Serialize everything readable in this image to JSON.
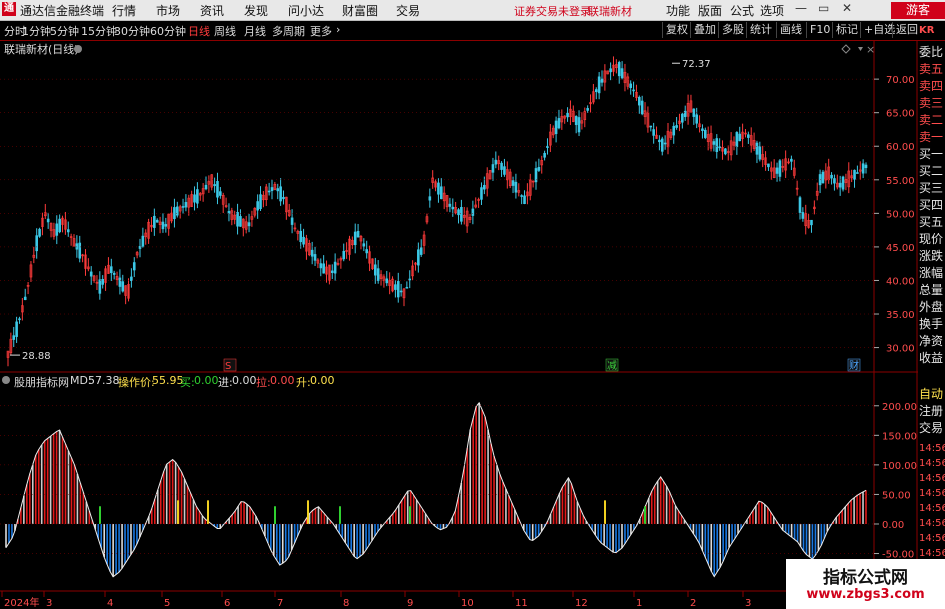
{
  "window": {
    "app_title": "通达信金融终端",
    "logo_glyph": "通",
    "menu": [
      "行情",
      "市场",
      "资讯",
      "发现",
      "问小达",
      "财富圈",
      "交易"
    ],
    "notice": "证券交易未登录",
    "stock_name": "联瑞新材",
    "right_menu": [
      "功能",
      "版面",
      "公式",
      "选项"
    ],
    "window_controls": [
      "—",
      "▭",
      "✕"
    ],
    "guest_label": "游客"
  },
  "periods": {
    "items": [
      "分时",
      "1分钟",
      "5分钟",
      "15分钟",
      "30分钟",
      "60分钟",
      "日线",
      "周线",
      "月线",
      "多周期",
      "更多"
    ],
    "active": "日线",
    "more_arrow": "›"
  },
  "toolbar_right": [
    "复权",
    "叠加",
    "多股",
    "统计",
    "画线",
    "F10",
    "标记",
    "+自选",
    "返回"
  ],
  "main_panel": {
    "title": "联瑞新材(日线)",
    "y_ticks": [
      "70.00",
      "65.00",
      "60.00",
      "55.00",
      "50.00",
      "45.00",
      "40.00",
      "35.00",
      "30.00"
    ],
    "high_label": "72.37",
    "low_label": "28.88",
    "event_marks": [
      {
        "text": "S",
        "color": "#ff3b3b"
      },
      {
        "text": "减",
        "color": "#3bd23b"
      },
      {
        "text": "财",
        "color": "#4da6ff"
      }
    ]
  },
  "indicator_panel": {
    "name": "股朋指标网",
    "md_label": "MD:",
    "md_value": "57.38",
    "op_label": "操作价:",
    "op_value": "55.95",
    "buy_label": "买:",
    "buy_value": "0.00",
    "in_label": "进:",
    "in_value": "0.00",
    "pull_label": "拉:",
    "pull_value": "0.00",
    "up_label": "升:",
    "up_value": "0.00",
    "y_ticks": [
      "200.00",
      "150.00",
      "100.00",
      "50.00",
      "0.00",
      "-50.00"
    ]
  },
  "x_axis": {
    "labels": [
      "2024年",
      "3",
      "4",
      "5",
      "6",
      "7",
      "8",
      "9",
      "10",
      "11",
      "12",
      "1",
      "2",
      "3",
      "4"
    ]
  },
  "side_panel": {
    "code": "KR",
    "labels": [
      "委比",
      "卖五",
      "卖四",
      "卖三",
      "卖二",
      "卖一",
      "买一",
      "买二",
      "买三",
      "买四",
      "买五",
      "现价",
      "涨跌",
      "涨幅",
      "总量",
      "外盘",
      "换手",
      "净资",
      "收益"
    ],
    "bottom_labels": [
      "自动",
      "注册",
      "交易"
    ],
    "times": [
      "14:56",
      "14:56",
      "14:56",
      "14:56",
      "14:56",
      "14:56",
      "14:56",
      "14:56"
    ]
  },
  "watermark": {
    "line1": "指标公式网",
    "line2": "www.zbgs3.com"
  },
  "colors": {
    "up": "#ff3b3b",
    "down": "#3cc8e6",
    "grid": "#8b0000",
    "pos_bar": "#e01a1a",
    "neg_bar": "#1a78e0",
    "signal_green": "#30d030",
    "signal_yellow": "#f0d020"
  },
  "chart_data": [
    {
      "type": "candlestick",
      "title": "联瑞新材(日线)",
      "ylim": [
        28,
        73
      ],
      "high": 72.37,
      "low": 28.88,
      "series": [
        {
          "values": [
            29,
            33,
            38,
            45,
            50,
            47,
            49,
            46,
            44,
            41,
            39,
            42,
            40,
            38,
            44,
            47,
            49,
            48,
            50,
            51,
            52,
            53,
            55,
            53,
            50,
            49,
            48,
            51,
            53,
            54,
            52,
            48,
            46,
            44,
            42,
            41,
            43,
            45,
            47,
            44,
            41,
            40,
            39,
            38,
            42,
            45,
            55,
            53,
            51,
            50,
            49,
            52,
            55,
            58,
            56,
            54,
            52,
            55,
            58,
            62,
            64,
            65,
            63,
            66,
            69,
            71,
            72,
            70,
            68,
            65,
            62,
            60,
            62,
            64,
            66,
            63,
            61,
            60,
            59,
            61,
            62,
            60,
            58,
            56,
            57,
            58,
            50,
            48,
            55,
            56,
            54,
            55,
            56,
            57
          ]
        }
      ]
    },
    {
      "type": "bar",
      "title": "股朋指标网",
      "ylim": [
        -110,
        225
      ],
      "series": [
        {
          "name": "MD",
          "values": [
            -40,
            -20,
            30,
            80,
            120,
            140,
            150,
            160,
            130,
            100,
            60,
            20,
            -20,
            -60,
            -90,
            -80,
            -60,
            -40,
            -10,
            20,
            60,
            100,
            110,
            90,
            60,
            30,
            10,
            0,
            -10,
            5,
            20,
            40,
            30,
            10,
            -20,
            -50,
            -70,
            -60,
            -30,
            0,
            20,
            30,
            15,
            0,
            -20,
            -40,
            -60,
            -50,
            -30,
            -10,
            5,
            20,
            40,
            60,
            40,
            20,
            0,
            -10,
            -5,
            20,
            80,
            160,
            210,
            180,
            120,
            80,
            50,
            20,
            -10,
            -30,
            -20,
            0,
            30,
            60,
            80,
            40,
            10,
            -10,
            -30,
            -40,
            -50,
            -40,
            -20,
            0,
            30,
            60,
            80,
            60,
            30,
            10,
            -10,
            -30,
            -60,
            -90,
            -70,
            -40,
            -20,
            0,
            20,
            40,
            30,
            10,
            -10,
            -20,
            -30,
            -50,
            -60,
            -40,
            -10,
            10,
            25,
            40,
            50,
            57
          ]
        }
      ]
    }
  ]
}
